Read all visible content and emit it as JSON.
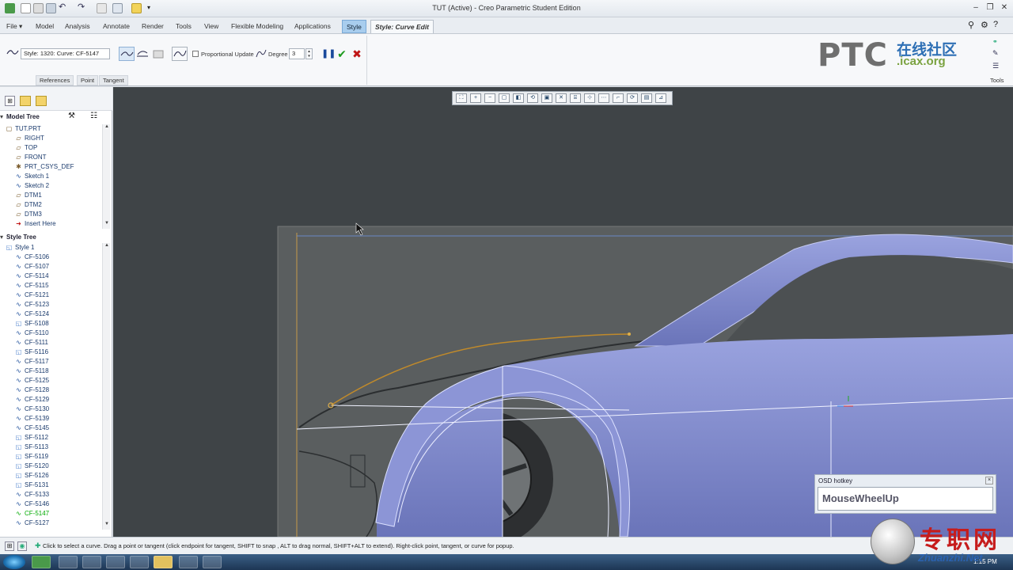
{
  "window": {
    "title": "TUT (Active) - Creo Parametric Student Edition"
  },
  "tabs": [
    {
      "label": "File ▾"
    },
    {
      "label": "Model"
    },
    {
      "label": "Analysis"
    },
    {
      "label": "Annotate"
    },
    {
      "label": "Render"
    },
    {
      "label": "Tools"
    },
    {
      "label": "View"
    },
    {
      "label": "Flexible Modeling"
    },
    {
      "label": "Applications"
    },
    {
      "label": "Style"
    },
    {
      "label": "Style: Curve Edit"
    }
  ],
  "ribbon": {
    "style_field": "Style: 1320: Curve:  CF-5147",
    "proportional_update": "Proportional Update",
    "degree_label": "Degree",
    "degree_value": "3",
    "sections": [
      "References",
      "Point",
      "Tangent"
    ],
    "tools_label": "Tools"
  },
  "logo": {
    "text": "PTC",
    "cn": "在线社区",
    "org": ".icax.org"
  },
  "model_tree": {
    "header": "Model Tree",
    "items": [
      {
        "label": "TUT.PRT",
        "icon": "part-icon"
      },
      {
        "label": "RIGHT",
        "icon": "datum-plane-icon"
      },
      {
        "label": "TOP",
        "icon": "datum-plane-icon"
      },
      {
        "label": "FRONT",
        "icon": "datum-plane-icon"
      },
      {
        "label": "PRT_CSYS_DEF",
        "icon": "csys-icon"
      },
      {
        "label": "Sketch 1",
        "icon": "sketch-icon"
      },
      {
        "label": "Sketch 2",
        "icon": "sketch-icon"
      },
      {
        "label": "DTM1",
        "icon": "datum-plane-icon"
      },
      {
        "label": "DTM2",
        "icon": "datum-plane-icon"
      },
      {
        "label": "DTM3",
        "icon": "datum-plane-icon"
      },
      {
        "label": "Insert Here",
        "icon": "insert-arrow-icon"
      }
    ]
  },
  "style_tree": {
    "header": "Style Tree",
    "items": [
      {
        "label": "Style 1",
        "kind": "root"
      },
      {
        "label": "CF-5106",
        "kind": "cf"
      },
      {
        "label": "CF-5107",
        "kind": "cf"
      },
      {
        "label": "CF-5114",
        "kind": "cf"
      },
      {
        "label": "CF-5115",
        "kind": "cf"
      },
      {
        "label": "CF-5121",
        "kind": "cf"
      },
      {
        "label": "CF-5123",
        "kind": "cf"
      },
      {
        "label": "CF-5124",
        "kind": "cf"
      },
      {
        "label": "SF-5108",
        "kind": "sf"
      },
      {
        "label": "CF-5110",
        "kind": "cf"
      },
      {
        "label": "CF-5111",
        "kind": "cf"
      },
      {
        "label": "SF-5116",
        "kind": "sf"
      },
      {
        "label": "CF-5117",
        "kind": "cf"
      },
      {
        "label": "CF-5118",
        "kind": "cf"
      },
      {
        "label": "CF-5125",
        "kind": "cf"
      },
      {
        "label": "CF-5128",
        "kind": "cf"
      },
      {
        "label": "CF-5129",
        "kind": "cf"
      },
      {
        "label": "CF-5130",
        "kind": "cf"
      },
      {
        "label": "CF-5139",
        "kind": "cf"
      },
      {
        "label": "CF-5145",
        "kind": "cf"
      },
      {
        "label": "SF-5112",
        "kind": "sf"
      },
      {
        "label": "SF-5113",
        "kind": "sf"
      },
      {
        "label": "SF-5119",
        "kind": "sf"
      },
      {
        "label": "SF-5120",
        "kind": "sf"
      },
      {
        "label": "SF-5126",
        "kind": "sf"
      },
      {
        "label": "SF-5131",
        "kind": "sf"
      },
      {
        "label": "CF-5133",
        "kind": "cf"
      },
      {
        "label": "CF-5146",
        "kind": "cf"
      },
      {
        "label": "CF-5147",
        "kind": "active"
      },
      {
        "label": "CF-5127",
        "kind": "cf"
      }
    ]
  },
  "osd": {
    "caption": "OSD hotkey",
    "text": "MouseWheelUp"
  },
  "status": {
    "message": "Click to select a curve.  Drag a point or tangent (click endpoint for tangent, SHIFT to snap , ALT to drag normal, SHIFT+ALT to extend). Right-click point, tangent, or curve for popup."
  },
  "taskbar": {
    "clock": "1:15 PM"
  },
  "watermark": {
    "cn": "专职网",
    "en": "Zhuanzhi.Net"
  },
  "colors": {
    "body": "#7f89c9",
    "viewport_bg": "#3f4447",
    "curve": "#c08a2b",
    "accent": "#a8cdee"
  }
}
